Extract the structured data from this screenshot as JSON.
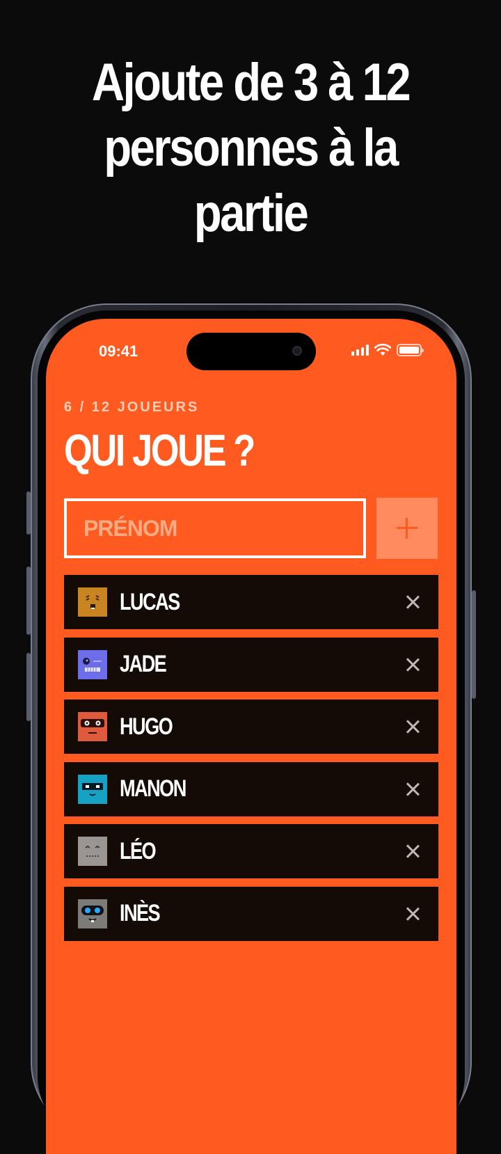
{
  "headline": {
    "line1": "Ajoute de 3 à 12",
    "line2": "personnes à la",
    "line3": "partie"
  },
  "status_bar": {
    "time": "09:41",
    "icons": [
      "signal-icon",
      "wifi-icon",
      "battery-icon"
    ]
  },
  "header": {
    "count_label": "6 / 12 JOUEURS",
    "title": "QUI JOUE ?"
  },
  "name_input": {
    "placeholder": "PRÉNOM",
    "value": ""
  },
  "add_button": {
    "icon": "plus-icon"
  },
  "players": [
    {
      "name": "LUCAS",
      "avatar": "avatar-lucas",
      "avatar_color": "#c88420"
    },
    {
      "name": "JADE",
      "avatar": "avatar-jade",
      "avatar_color": "#6b6ee8"
    },
    {
      "name": "HUGO",
      "avatar": "avatar-hugo",
      "avatar_color": "#e05a3e"
    },
    {
      "name": "MANON",
      "avatar": "avatar-manon",
      "avatar_color": "#16a2c4"
    },
    {
      "name": "LÉO",
      "avatar": "avatar-leo",
      "avatar_color": "#9a9593"
    },
    {
      "name": "INÈS",
      "avatar": "avatar-ines",
      "avatar_color": "#8a8a8a"
    }
  ],
  "colors": {
    "background": "#0b0b0b",
    "accent": "#ff5a1f",
    "row_background": "#140a06",
    "add_button": "#ff8a5d"
  }
}
